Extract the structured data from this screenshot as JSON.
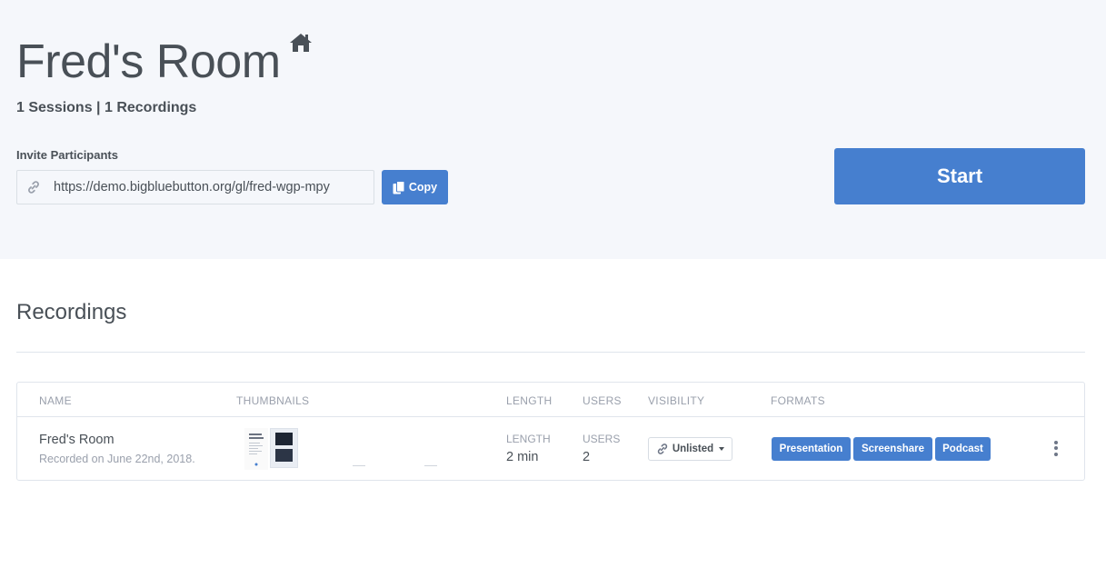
{
  "room": {
    "title": "Fred's Room",
    "stats": "1 Sessions | 1 Recordings",
    "invite_label": "Invite Participants",
    "invite_url": "https://demo.bigbluebutton.org/gl/fred-wgp-mpy",
    "copy_label": "Copy",
    "start_label": "Start"
  },
  "recordings": {
    "section_title": "Recordings",
    "columns": {
      "name": "NAME",
      "thumbnails": "THUMBNAILS",
      "length": "LENGTH",
      "users": "USERS",
      "visibility": "VISIBILITY",
      "formats": "FORMATS"
    },
    "rows": [
      {
        "name": "Fred's Room",
        "date": "Recorded on June 22nd, 2018.",
        "length_label": "LENGTH",
        "length": "2 min",
        "users_label": "USERS",
        "users": "2",
        "visibility": "Unlisted",
        "formats": [
          "Presentation",
          "Screenshare",
          "Podcast"
        ]
      }
    ]
  },
  "icons": {
    "home": "home-icon",
    "link": "link-icon",
    "copy": "copy-icon",
    "kebab": "kebab-menu-icon"
  },
  "colors": {
    "primary": "#467fcf",
    "hero_bg": "#f5f7fb",
    "text": "#495057",
    "muted": "#9aa0ac"
  }
}
